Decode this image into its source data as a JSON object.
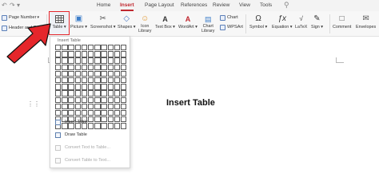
{
  "menubar": {
    "tabs": [
      "Home",
      "Insert",
      "Page Layout",
      "References",
      "Review",
      "View",
      "Tools"
    ],
    "active_tab": "Insert",
    "search_icon": "search-icon",
    "quick_access_icons": [
      "undo-icon",
      "redo-icon",
      "dropdown-icon"
    ]
  },
  "ribbon": {
    "page_number": "Page Number",
    "header_footer": "Header and Footer",
    "table": "Table",
    "picture": "Picture",
    "screenshot": "Screenshot",
    "shapes": "Shapes",
    "icon_library_1": "Icon",
    "icon_library_2": "Library",
    "text_box": "Text Box",
    "wordart": "WordArt",
    "chart_library_1": "Chart",
    "chart_library_2": "Library",
    "chart": "Chart",
    "wpsart": "WPSArt",
    "symbol": "Symbol",
    "equation": "Equation",
    "latex": "LaTeX",
    "sign": "Sign",
    "comment": "Comment",
    "envelopes": "Envelopes"
  },
  "dropdown": {
    "header": "Insert Table",
    "grid_cols": 11,
    "grid_rows": 13,
    "items": [
      {
        "label": "Insert Table",
        "enabled": true
      },
      {
        "label": "Draw Table",
        "enabled": true
      },
      {
        "label": "Convert Text to Table...",
        "enabled": false
      },
      {
        "label": "Convert Table to Text...",
        "enabled": false
      }
    ]
  },
  "document": {
    "title": "Insert Table"
  },
  "colors": {
    "accent": "#c0282f",
    "arrow": "#e5262b"
  }
}
